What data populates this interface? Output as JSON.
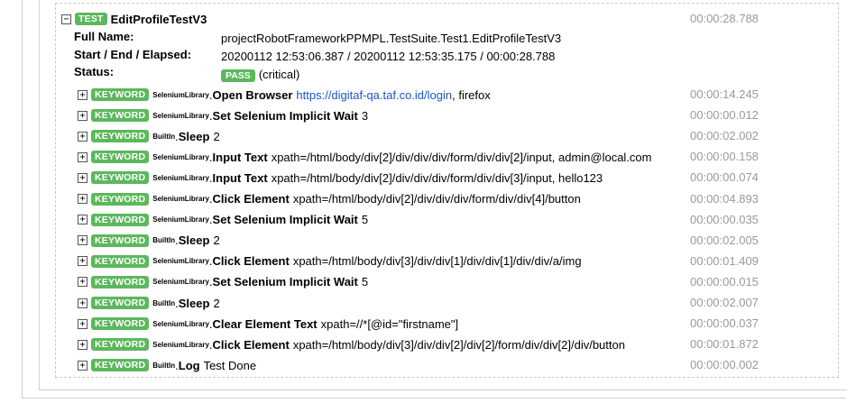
{
  "test": {
    "label": "TEST",
    "name": "EditProfileTestV3",
    "elapsed": "00:00:28.788",
    "full_name_label": "Full Name:",
    "full_name": "projectRobotFrameworkPPMPL.TestSuite.Test1.EditProfileTestV3",
    "times_label": "Start / End / Elapsed:",
    "times": "20200112 12:53:06.387 / 20200112 12:53:35.175 / 00:00:28.788",
    "status_label": "Status:",
    "status": "PASS",
    "status_note": "(critical)"
  },
  "keyword_label": "KEYWORD",
  "keywords": [
    {
      "lib": "SeleniumLibrary",
      "name": "Open Browser",
      "link": "https://digitaf-qa.taf.co.id/login",
      "args": ", firefox",
      "time": "00:00:14.245"
    },
    {
      "lib": "SeleniumLibrary",
      "name": "Set Selenium Implicit Wait",
      "args": "3",
      "time": "00:00:00.012"
    },
    {
      "lib": "BuiltIn",
      "name": "Sleep",
      "args": "2",
      "time": "00:00:02.002"
    },
    {
      "lib": "SeleniumLibrary",
      "name": "Input Text",
      "args": "xpath=/html/body/div[2]/div/div/div/form/div/div[2]/input, admin@local.com",
      "time": "00:00:00.158"
    },
    {
      "lib": "SeleniumLibrary",
      "name": "Input Text",
      "args": "xpath=/html/body/div[2]/div/div/div/form/div/div[3]/input, hello123",
      "time": "00:00:00.074"
    },
    {
      "lib": "SeleniumLibrary",
      "name": "Click Element",
      "args": "xpath=/html/body/div[2]/div/div/div/form/div/div[4]/button",
      "time": "00:00:04.893"
    },
    {
      "lib": "SeleniumLibrary",
      "name": "Set Selenium Implicit Wait",
      "args": "5",
      "time": "00:00:00.035"
    },
    {
      "lib": "BuiltIn",
      "name": "Sleep",
      "args": "2",
      "time": "00:00:02.005"
    },
    {
      "lib": "SeleniumLibrary",
      "name": "Click Element",
      "args": "xpath=/html/body/div[3]/div/div[1]/div/div[1]/div/div/a/img",
      "time": "00:00:01.409"
    },
    {
      "lib": "SeleniumLibrary",
      "name": "Set Selenium Implicit Wait",
      "args": "5",
      "time": "00:00:00.015"
    },
    {
      "lib": "BuiltIn",
      "name": "Sleep",
      "args": "2",
      "time": "00:00:02.007"
    },
    {
      "lib": "SeleniumLibrary",
      "name": "Clear Element Text",
      "args": "xpath=//*[@id=\"firstname\"]",
      "time": "00:00:00.037"
    },
    {
      "lib": "SeleniumLibrary",
      "name": "Click Element",
      "args": "xpath=/html/body/div[3]/div/div[2]/div[2]/form/div/div[2]/div/button",
      "time": "00:00:01.872"
    },
    {
      "lib": "BuiltIn",
      "name": "Log",
      "args": "Test Done",
      "time": "00:00:00.002"
    }
  ]
}
